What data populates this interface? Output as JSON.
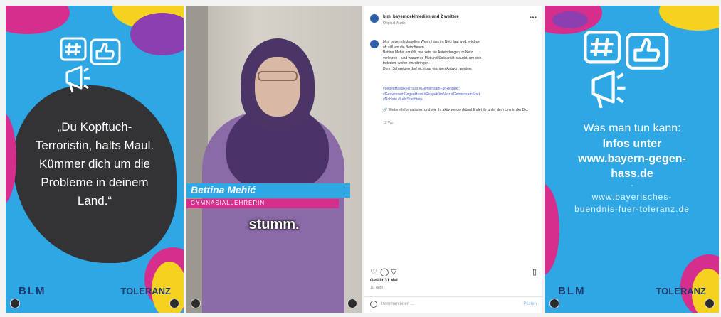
{
  "panel1": {
    "quote_lines": [
      "„Du Kopftuch-",
      "Terroristin, halts Maul.",
      "Kümmer dich um die",
      "Probleme in deinem",
      "Land.“"
    ],
    "logo_left": "BLM",
    "logo_right": "TOLERANZ"
  },
  "panel2": {
    "name": "Bettina Mehić",
    "role": "GYMNASIALLEHRERIN",
    "subtitle": "stumm."
  },
  "panel3": {
    "username": "blm_bayerndeklmedien und 2 weitere",
    "subtitle": "Original-Audio",
    "more_icon": "more-horizontal-icon",
    "caption_lines": [
      "blm_bayerndeklmedien Wenn Hass im Netz laut wird, wird es",
      "oft still um die Betroffenen.",
      "Bettina Mehic erzählt, wie sehr sie Anfeindungen im Netz",
      "verletzen – und warum es Mut und Solidarität braucht, um sich",
      "trotzdem weiter einzubringen.",
      "Denn Schweigen darf nicht zur einzigen Antwort werden."
    ],
    "hashtag_lines": [
      "#gegenHassReerhass #GemeinsamFürRespekt",
      "#GemeinsamGegenHass #RespektImNetz #GemeinsamStark",
      "#NoHate #LehrStattHass"
    ],
    "more_info": "🔗 Weitere Informationen und wie ihr aktiv werden könnt findet ihr unter dem Link in der Bio.",
    "time": "12 Wo.",
    "likes": "Gefällt 31 Mal",
    "date": "11. April",
    "comment_placeholder": "Kommentieren ...",
    "post_label": "Posten"
  },
  "panel4": {
    "line1": "Was man tun kann:",
    "line2": "Infos unter",
    "line3": "www.bayern-gegen-",
    "line4": "hass.de",
    "sep": "-",
    "line5": "www.bayerisches-",
    "line6": "buendnis-fuer-toleranz.de",
    "logo_left": "BLM",
    "logo_right": "TOLERANZ"
  },
  "colors": {
    "brand_blue": "#2ea7e4",
    "magenta": "#d62e8c",
    "yellow": "#f4d21f",
    "navy": "#1e3a70"
  }
}
